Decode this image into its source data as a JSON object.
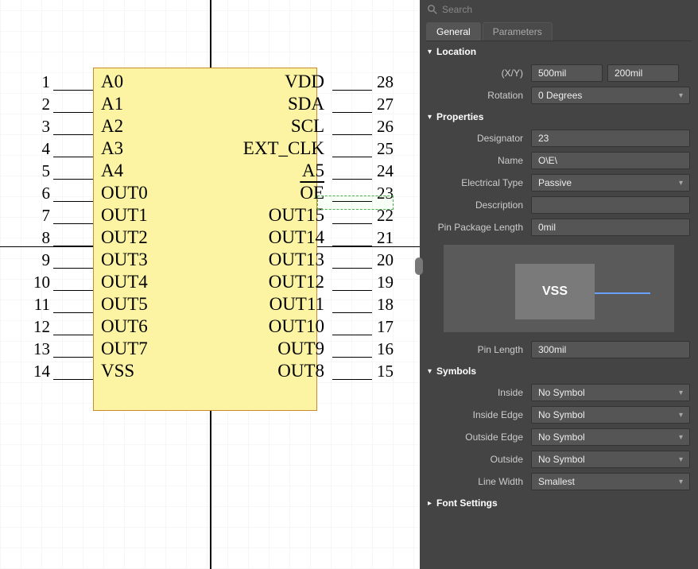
{
  "search_placeholder": "Search",
  "tabs": {
    "general": "General",
    "parameters": "Parameters"
  },
  "sections": {
    "location": "Location",
    "properties": "Properties",
    "symbols": "Symbols",
    "font_settings": "Font Settings"
  },
  "location": {
    "xy_label": "(X/Y)",
    "x": "500mil",
    "y": "200mil",
    "rotation_label": "Rotation",
    "rotation": "0 Degrees"
  },
  "properties": {
    "designator_label": "Designator",
    "designator": "23",
    "name_label": "Name",
    "name": "O\\E\\",
    "etype_label": "Electrical Type",
    "etype": "Passive",
    "description_label": "Description",
    "description": "",
    "ppl_label": "Pin Package Length",
    "ppl": "0mil",
    "preview_text": "VSS",
    "pinlen_label": "Pin Length",
    "pinlen": "300mil"
  },
  "symbols": {
    "inside_label": "Inside",
    "inside": "No Symbol",
    "inside_edge_label": "Inside Edge",
    "inside_edge": "No Symbol",
    "outside_edge_label": "Outside Edge",
    "outside_edge": "No Symbol",
    "outside_label": "Outside",
    "outside": "No Symbol",
    "linewidth_label": "Line Width",
    "linewidth": "Smallest"
  },
  "chip": {
    "left_pins": [
      {
        "num": "1",
        "label": "A0"
      },
      {
        "num": "2",
        "label": "A1"
      },
      {
        "num": "3",
        "label": "A2"
      },
      {
        "num": "4",
        "label": "A3"
      },
      {
        "num": "5",
        "label": "A4"
      },
      {
        "num": "6",
        "label": "OUT0"
      },
      {
        "num": "7",
        "label": "OUT1"
      },
      {
        "num": "8",
        "label": "OUT2"
      },
      {
        "num": "9",
        "label": "OUT3"
      },
      {
        "num": "10",
        "label": "OUT4"
      },
      {
        "num": "11",
        "label": "OUT5"
      },
      {
        "num": "12",
        "label": "OUT6"
      },
      {
        "num": "13",
        "label": "OUT7"
      },
      {
        "num": "14",
        "label": "VSS"
      }
    ],
    "right_pins": [
      {
        "num": "28",
        "label": "VDD"
      },
      {
        "num": "27",
        "label": "SDA"
      },
      {
        "num": "26",
        "label": "SCL"
      },
      {
        "num": "25",
        "label": "EXT_CLK"
      },
      {
        "num": "24",
        "label": "A5"
      },
      {
        "num": "23",
        "label": "OE",
        "overline": true
      },
      {
        "num": "22",
        "label": "OUT15"
      },
      {
        "num": "21",
        "label": "OUT14"
      },
      {
        "num": "20",
        "label": "OUT13"
      },
      {
        "num": "19",
        "label": "OUT12"
      },
      {
        "num": "18",
        "label": "OUT11"
      },
      {
        "num": "17",
        "label": "OUT10"
      },
      {
        "num": "16",
        "label": "OUT9"
      },
      {
        "num": "15",
        "label": "OUT8"
      }
    ]
  }
}
